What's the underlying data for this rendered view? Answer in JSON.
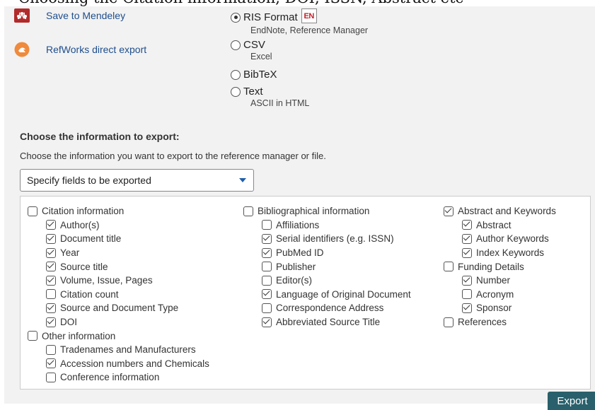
{
  "top_strip": {
    "text": "Choosing the Citation information, DOI, ISSN, Abstract etc"
  },
  "managers": [
    {
      "label": "Save to Mendeley",
      "icon": "mendeley-icon",
      "color": "#b22a2a"
    },
    {
      "label": "RefWorks direct export",
      "icon": "refworks-icon",
      "color": "#f08a3c"
    }
  ],
  "formats": [
    {
      "label": "RIS Format",
      "sub": "EndNote, Reference Manager",
      "selected": true,
      "badge": "EN"
    },
    {
      "label": "CSV",
      "sub": "Excel",
      "selected": false
    },
    {
      "label": "BibTeX",
      "sub": "",
      "selected": false
    },
    {
      "label": "Text",
      "sub": "ASCII in HTML",
      "selected": false
    }
  ],
  "choose": {
    "title": "Choose the information to export:",
    "description": "Choose the information you want to export to the reference manager or file.",
    "select_value": "Specify fields to be exported"
  },
  "field_columns": [
    [
      {
        "label": "Citation information",
        "checked": false,
        "indent": false
      },
      {
        "label": "Author(s)",
        "checked": true,
        "indent": true
      },
      {
        "label": "Document title",
        "checked": true,
        "indent": true
      },
      {
        "label": "Year",
        "checked": true,
        "indent": true
      },
      {
        "label": "Source title",
        "checked": true,
        "indent": true
      },
      {
        "label": "Volume, Issue, Pages",
        "checked": true,
        "indent": true
      },
      {
        "label": "Citation count",
        "checked": false,
        "indent": true
      },
      {
        "label": "Source and Document Type",
        "checked": true,
        "indent": true
      },
      {
        "label": "DOI",
        "checked": true,
        "indent": true
      },
      {
        "label": "Other information",
        "checked": false,
        "indent": false
      },
      {
        "label": "Tradenames and Manufacturers",
        "checked": false,
        "indent": true
      },
      {
        "label": "Accession numbers and Chemicals",
        "checked": true,
        "indent": true
      },
      {
        "label": "Conference information",
        "checked": false,
        "indent": true
      }
    ],
    [
      {
        "label": "Bibliographical information",
        "checked": false,
        "indent": false
      },
      {
        "label": "Affiliations",
        "checked": false,
        "indent": true
      },
      {
        "label": "Serial identifiers (e.g. ISSN)",
        "checked": true,
        "indent": true
      },
      {
        "label": "PubMed ID",
        "checked": true,
        "indent": true
      },
      {
        "label": "Publisher",
        "checked": false,
        "indent": true
      },
      {
        "label": "Editor(s)",
        "checked": false,
        "indent": true
      },
      {
        "label": "Language of Original Document",
        "checked": true,
        "indent": true
      },
      {
        "label": "Correspondence Address",
        "checked": false,
        "indent": true
      },
      {
        "label": "Abbreviated Source Title",
        "checked": true,
        "indent": true
      }
    ],
    [
      {
        "label": "Abstract and Keywords",
        "checked": true,
        "indent": false
      },
      {
        "label": "Abstract",
        "checked": true,
        "indent": true
      },
      {
        "label": "Author Keywords",
        "checked": true,
        "indent": true
      },
      {
        "label": "Index Keywords",
        "checked": true,
        "indent": true
      },
      {
        "label": "Funding Details",
        "checked": false,
        "indent": false
      },
      {
        "label": "Number",
        "checked": true,
        "indent": true
      },
      {
        "label": "Acronym",
        "checked": false,
        "indent": true
      },
      {
        "label": "Sponsor",
        "checked": true,
        "indent": true
      },
      {
        "label": "References",
        "checked": false,
        "indent": false
      }
    ]
  ],
  "export_label": "Export",
  "colors": {
    "link": "#1f4e8c",
    "export_button": "#29606b",
    "panel": "#f2f2f2",
    "caret": "#1f5fa8"
  }
}
